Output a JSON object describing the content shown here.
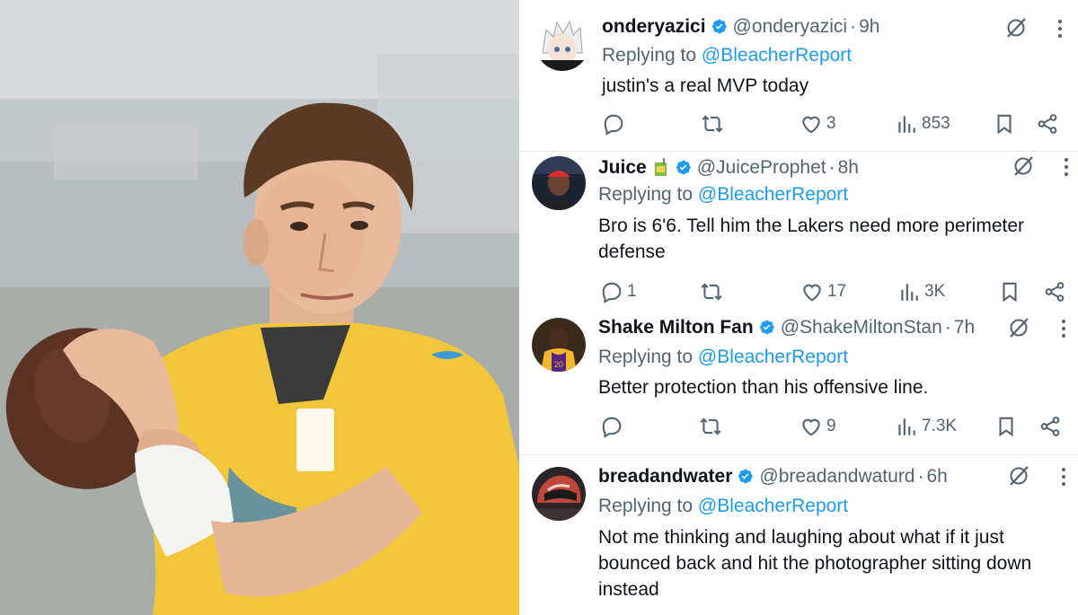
{
  "tweets": [
    {
      "name": "onderyazici",
      "emoji": "",
      "handle": "@onderyazici",
      "time": "9h",
      "reply_prefix": "Replying to",
      "reply_to": "@BleacherReport",
      "text": "justin's a real MVP today",
      "actions": {
        "replies": "",
        "retweets": "",
        "likes": "3",
        "views": "853"
      },
      "avatar_icon": "anime-avatar"
    },
    {
      "name": "Juice",
      "emoji": "juice-box-emoji",
      "handle": "@JuiceProphet",
      "time": "8h",
      "reply_prefix": "Replying to",
      "reply_to": "@BleacherReport",
      "text": "Bro is 6'6. Tell him the Lakers need more perimeter defense",
      "actions": {
        "replies": "1",
        "retweets": "",
        "likes": "17",
        "views": "3K"
      },
      "avatar_icon": "person-red-cap-avatar"
    },
    {
      "name": "Shake Milton Fan",
      "emoji": "",
      "handle": "@ShakeMiltonStan",
      "time": "7h",
      "reply_prefix": "Replying to",
      "reply_to": "@BleacherReport",
      "text": "Better protection than his offensive line.",
      "actions": {
        "replies": "",
        "retweets": "",
        "likes": "9",
        "views": "7.3K"
      },
      "avatar_icon": "lakers-player-avatar"
    },
    {
      "name": "breadandwater",
      "emoji": "",
      "handle": "@breadandwaturd",
      "time": "6h",
      "reply_prefix": "Replying to",
      "reply_to": "@BleacherReport",
      "text": "Not me thinking and laughing about what if it just bounced back and hit the photographer sitting down instead",
      "actions": {
        "replies": "",
        "retweets": "",
        "likes": "",
        "views": ""
      },
      "avatar_icon": "helmet-avatar"
    }
  ],
  "colors": {
    "accent": "#1d9bf0",
    "text": "#0f1419",
    "secondary": "#536471",
    "jersey": "#f2c63a"
  },
  "icons": [
    "reply-icon",
    "retweet-icon",
    "like-icon",
    "views-icon",
    "bookmark-icon",
    "share-icon",
    "grok-icon",
    "more-icon",
    "verified-badge-icon"
  ],
  "photo": {
    "subject": "quarterback-photo"
  }
}
